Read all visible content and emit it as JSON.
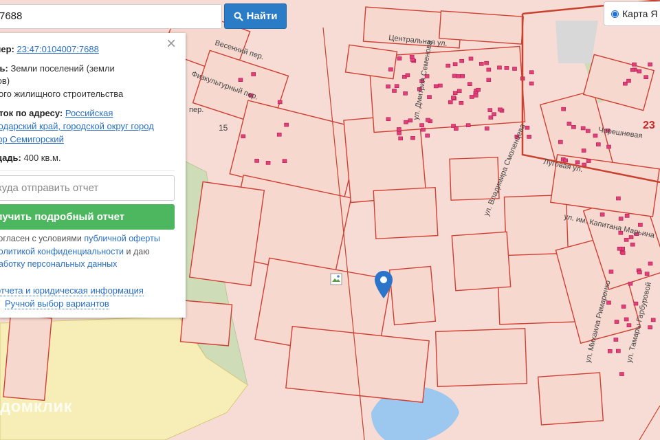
{
  "search": {
    "value": "7688",
    "button_label": "Найти"
  },
  "map_type": {
    "label": "Карта Я"
  },
  "info_panel": {
    "cadastral_label": "омер:",
    "cadastral_number": "23:47:0104007:7688",
    "purpose_label": "ель:",
    "purpose_value_line1": "Земли поселений (земли",
    "purpose_value_line2": "ктов)",
    "purpose_value_line3": "ьного жилищного строительства",
    "address_label": "асток по адресу:",
    "address_line1": "Российская",
    "address_line2": "снодарский край, городской округ город",
    "address_line3": "утор Семигорский",
    "area_label": "ощадь:",
    "area_value": "400 кв.м.",
    "email_placeholder": "куда отправить отчет",
    "report_button_label": "лучить подробный отчет",
    "agree_prefix": "согласен с условиями ",
    "agree_offer_link": "публичной оферты",
    "agree_privacy_link": "политикой конфиденциальности",
    "agree_middle": " и даю",
    "agree_processing_link": "работку персональных данных",
    "report_info_link": "отчета и юридическая информация",
    "manual_select_link": "Ручной выбор вариантов"
  },
  "map": {
    "street_labels": [
      "Центральная ул.",
      "Весенний пер.",
      "Физкультурный пер.",
      "пер.",
      "Черешневая",
      "Луговая ул.",
      "ул. Владимира Смоленцева",
      "ул. Дмитрия Семенова",
      "ул. Михаила Римаренко",
      "ул. Тамары Гарбуровой",
      "ул. им. Капитана Марьина"
    ],
    "number_labels": [
      "15",
      "23"
    ],
    "watermark": "домклик",
    "colors": {
      "parcel_fill": "#f7d8cf",
      "parcel_stroke": "#d24a3c",
      "building": "#e0407a",
      "forest": "#c8d8b0",
      "field": "#f7efb0",
      "water": "#9ac8f0",
      "pin": "#2a74c9",
      "accent_button": "#2a7cc7",
      "report_button": "#4cb75e"
    }
  }
}
